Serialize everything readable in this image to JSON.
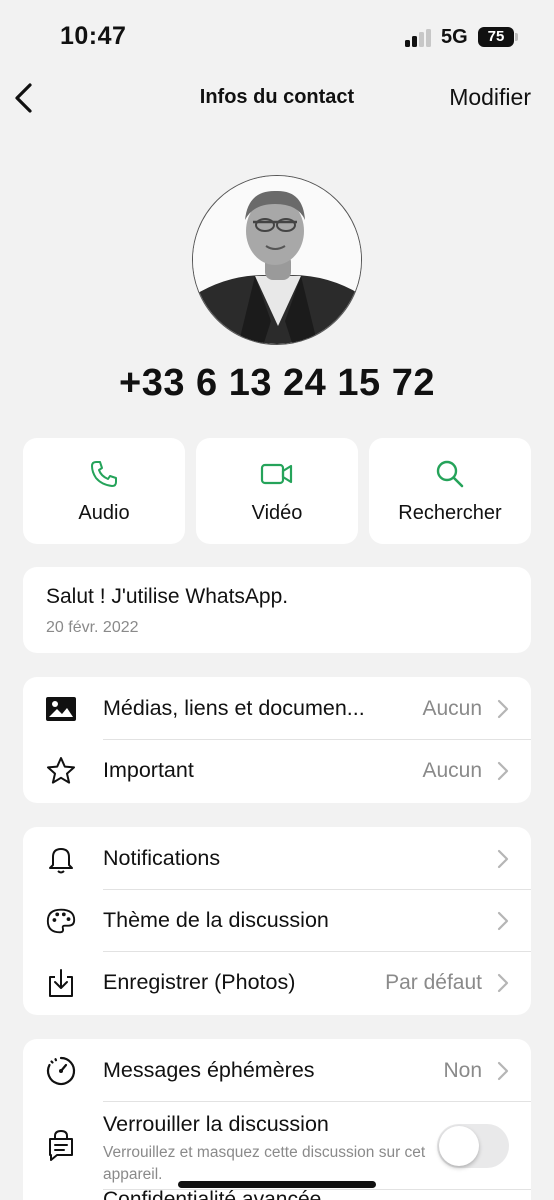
{
  "status_bar": {
    "time": "10:47",
    "network": "5G",
    "battery": "75"
  },
  "nav": {
    "title": "Infos du contact",
    "edit": "Modifier"
  },
  "contact": {
    "phone": "+33 6 13 24 15 72"
  },
  "actions": [
    {
      "label": "Audio",
      "icon": "phone-icon"
    },
    {
      "label": "Vidéo",
      "icon": "video-icon"
    },
    {
      "label": "Rechercher",
      "icon": "search-icon"
    }
  ],
  "about": {
    "text": "Salut ! J'utilise WhatsApp.",
    "date": "20 févr. 2022"
  },
  "media_section": [
    {
      "label": "Médias, liens et documen...",
      "value": "Aucun",
      "icon": "image-icon"
    },
    {
      "label": "Important",
      "value": "Aucun",
      "icon": "star-icon"
    }
  ],
  "settings_section": [
    {
      "label": "Notifications",
      "value": "",
      "icon": "bell-icon"
    },
    {
      "label": "Thème de la discussion",
      "value": "",
      "icon": "palette-icon"
    },
    {
      "label": "Enregistrer (Photos)",
      "value": "Par défaut",
      "icon": "download-icon"
    }
  ],
  "privacy_section": {
    "ephemeral": {
      "label": "Messages éphémères",
      "value": "Non",
      "icon": "timer-icon"
    },
    "lock": {
      "title": "Verrouiller la discussion",
      "subtitle": "Verrouillez et masquez cette discussion sur cet appareil.",
      "enabled": false,
      "icon": "lock-chat-icon"
    },
    "partial_label": "Confidentialité avancée"
  },
  "colors": {
    "accent": "#25a35a",
    "background": "#f2f2f2",
    "card": "#ffffff",
    "secondary_text": "#8a8a8a"
  }
}
